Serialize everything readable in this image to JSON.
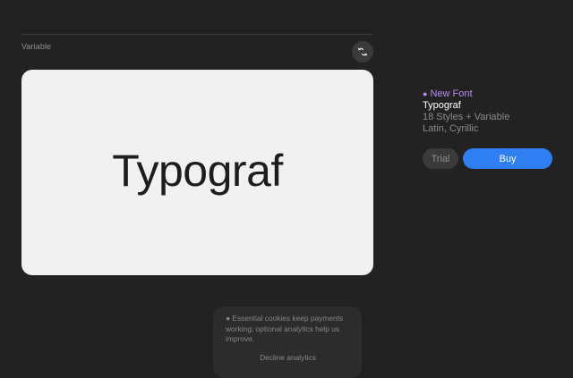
{
  "header": {
    "variable_label": "Variable"
  },
  "preview": {
    "sample_text": "Typograf"
  },
  "font_info": {
    "badge_dot": "●",
    "badge_label": "New Font",
    "name": "Typograf",
    "styles": "18 Styles + Variable",
    "scripts": "Latin, Cyrillic"
  },
  "actions": {
    "trial_label": "Trial",
    "buy_label": "Buy"
  },
  "cookie_banner": {
    "message": "● Essential cookies keep payments working; optional analytics help us improve.",
    "decline_label": "Decline analytics"
  },
  "icons": {
    "toggle": "switch-arrows-icon"
  },
  "colors": {
    "background": "#222222",
    "card": "#f1f1f1",
    "badge": "#b98cf0",
    "buy": "#2f7ff2"
  }
}
